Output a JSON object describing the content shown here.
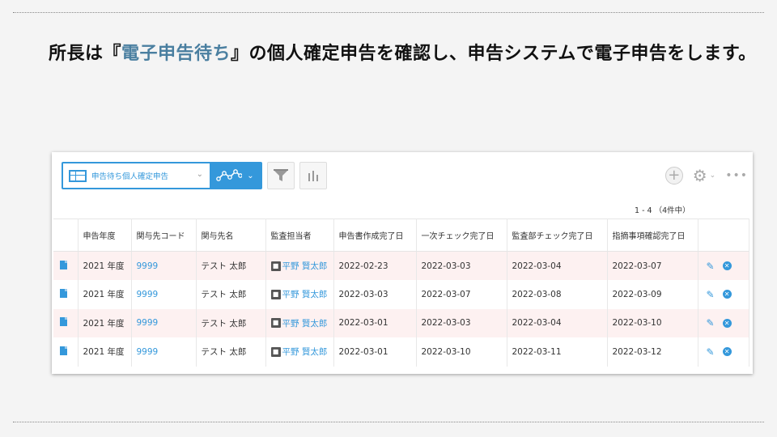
{
  "heading": {
    "prefix": "所長は『",
    "highlight": "電子申告待ち",
    "suffix": "』の個人確定申告を確認し、申告システムで電子申告をします。"
  },
  "toolbar": {
    "view_label": "申告待ち個人確定申告",
    "view_icon": "table-icon",
    "graph_menu_icon": "line-chart-icon",
    "filter_icon": "filter-icon",
    "graph_icon": "bar-graph-icon",
    "add_icon": "plus-icon",
    "settings_icon": "gear-icon",
    "more_icon": "more-dots-icon"
  },
  "pager": {
    "text": "1 - 4 （4件中）"
  },
  "table": {
    "columns": [
      "申告年度",
      "関与先コード",
      "関与先名",
      "監査担当者",
      "申告書作成完了日",
      "一次チェック完了日",
      "監査部チェック完了日",
      "指摘事項確認完了日"
    ],
    "rows": [
      {
        "year": "2021 年度",
        "code": "9999",
        "name": "テスト 太郎",
        "auditor": "平野 賢太郎",
        "d1": "2022-02-23",
        "d2": "2022-03-03",
        "d3": "2022-03-04",
        "d4": "2022-03-07"
      },
      {
        "year": "2021 年度",
        "code": "9999",
        "name": "テスト 太郎",
        "auditor": "平野 賢太郎",
        "d1": "2022-03-03",
        "d2": "2022-03-07",
        "d3": "2022-03-08",
        "d4": "2022-03-09"
      },
      {
        "year": "2021 年度",
        "code": "9999",
        "name": "テスト 太郎",
        "auditor": "平野 賢太郎",
        "d1": "2022-03-01",
        "d2": "2022-03-03",
        "d3": "2022-03-04",
        "d4": "2022-03-10"
      },
      {
        "year": "2021 年度",
        "code": "9999",
        "name": "テスト 太郎",
        "auditor": "平野 賢太郎",
        "d1": "2022-03-01",
        "d2": "2022-03-10",
        "d3": "2022-03-11",
        "d4": "2022-03-12"
      }
    ]
  },
  "colors": {
    "accent": "#3498db",
    "highlight_text": "#4a7fa0",
    "row_stripe": "#fdf1f1"
  }
}
